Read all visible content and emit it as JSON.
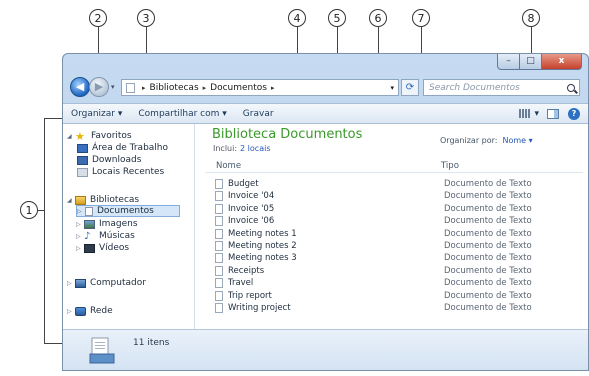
{
  "callouts": [
    "1",
    "2",
    "3",
    "4",
    "5",
    "6",
    "7",
    "8"
  ],
  "window": {
    "title_buttons": {
      "minimize": "–",
      "maximize": "□",
      "close": "x"
    }
  },
  "nav": {
    "back_glyph": "◀",
    "forward_glyph": "▶",
    "dropdown_glyph": "▾",
    "address": {
      "parts": [
        "Bibliotecas",
        "Documentos"
      ],
      "sep": "▸",
      "dropdown": "▾"
    },
    "refresh_glyph": "⟳",
    "search_placeholder": "Search Documentos"
  },
  "toolbar": {
    "organize": "Organizar ▾",
    "share": "Compartilhar com ▾",
    "burn": "Gravar",
    "view_dd": "▾",
    "help": "?"
  },
  "navpane": {
    "favorites": {
      "label": "Favoritos",
      "items": [
        "Área de Trabalho",
        "Downloads",
        "Locais Recentes"
      ]
    },
    "libraries": {
      "label": "Bibliotecas",
      "items": [
        "Documentos",
        "Imagens",
        "Músicas",
        "Vídeos"
      ]
    },
    "computer": "Computador",
    "network": "Rede"
  },
  "content": {
    "title": "Biblioteca Documentos",
    "includes_label": "Inclui:",
    "includes_link": "2 locais",
    "arrange_label": "Organizar por:",
    "arrange_value": "Nome ▾",
    "columns": {
      "name": "Nome",
      "type": "Tipo"
    },
    "files": [
      {
        "name": "Budget",
        "type": "Documento de Texto"
      },
      {
        "name": "Invoice '04",
        "type": "Documento de Texto"
      },
      {
        "name": "Invoice '05",
        "type": "Documento de Texto"
      },
      {
        "name": "Invoice '06",
        "type": "Documento de Texto"
      },
      {
        "name": "Meeting notes 1",
        "type": "Documento de Texto"
      },
      {
        "name": "Meeting notes 2",
        "type": "Documento de Texto"
      },
      {
        "name": "Meeting notes 3",
        "type": "Documento de Texto"
      },
      {
        "name": "Receipts",
        "type": "Documento de Texto"
      },
      {
        "name": "Travel",
        "type": "Documento de Texto"
      },
      {
        "name": "Trip report",
        "type": "Documento de Texto"
      },
      {
        "name": "Writing project",
        "type": "Documento de Texto"
      }
    ]
  },
  "status": {
    "count": "11 itens"
  },
  "colors": {
    "accent": "#2458b8",
    "library_title": "#3a9a2a",
    "close_button": "#c5402b"
  }
}
